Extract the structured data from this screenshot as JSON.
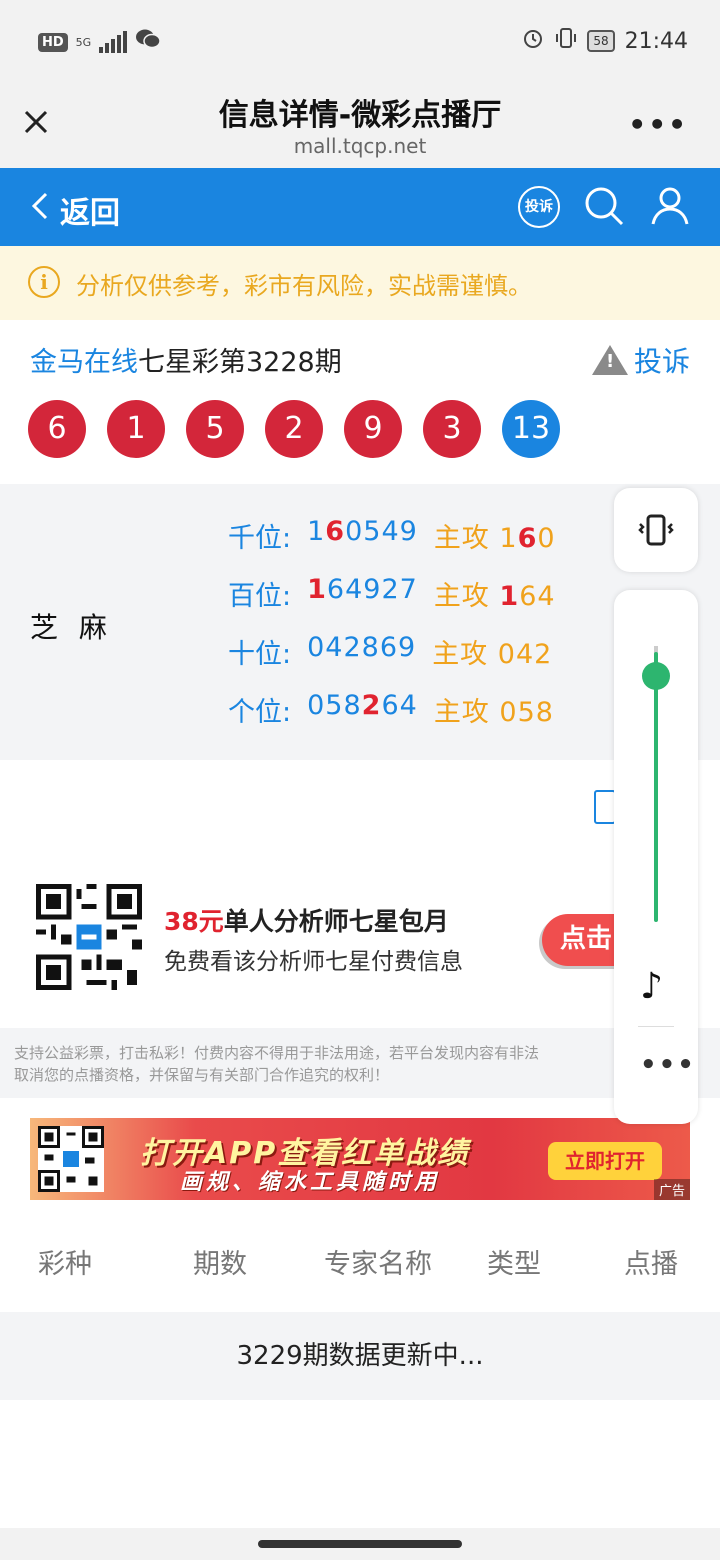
{
  "status_bar": {
    "hd": "HD",
    "network": "5G",
    "battery": "58",
    "time": "21:44"
  },
  "title_bar": {
    "title": "信息详情-微彩点播厅",
    "url": "mall.tqcp.net"
  },
  "nav": {
    "back_label": "返回",
    "complaint_label": "投诉"
  },
  "notice": {
    "text": "分析仅供参考，彩市有风险，实战需谨慎。"
  },
  "lottery": {
    "source": "金马在线",
    "title": "七星彩第3228期",
    "report_label": "投诉",
    "balls": [
      "6",
      "1",
      "5",
      "2",
      "9",
      "3",
      "13"
    ]
  },
  "analysis": {
    "author": "芝 麻",
    "rows": [
      {
        "pos": "千位:",
        "nums_pre": "1",
        "nums_hl": "6",
        "nums_post": "0549",
        "main_label": "主攻",
        "main_pre": "1",
        "main_hl": "6",
        "main_post": "0"
      },
      {
        "pos": "百位:",
        "nums_pre": "",
        "nums_hl": "1",
        "nums_post": "64927",
        "main_label": "主攻",
        "main_pre": "",
        "main_hl": "1",
        "main_post": "64"
      },
      {
        "pos": "十位:",
        "nums_pre": "042869",
        "nums_hl": "",
        "nums_post": "",
        "main_label": "主攻",
        "main_pre": "042",
        "main_hl": "",
        "main_post": ""
      },
      {
        "pos": "个位:",
        "nums_pre": "058",
        "nums_hl": "2",
        "nums_post": "64",
        "main_label": "主攻",
        "main_pre": "058",
        "main_hl": "",
        "main_post": ""
      }
    ]
  },
  "promo": {
    "price": "38元",
    "title": "单人分析师七星包月",
    "subtitle": "免费看该分析师七星付费信息",
    "button": "点击"
  },
  "disclaimer": {
    "line1": "支持公益彩票，打击私彩！付费内容不得用于非法用途，若平台发现内容有非法",
    "line2": "取消您的点播资格，并保留与有关部门合作追究的权利！"
  },
  "ad": {
    "line1": "打开APP查看红单战绩",
    "line2": "画规、缩水工具随时用",
    "button": "立即打开",
    "tag": "广告"
  },
  "table": {
    "headers": [
      "彩种",
      "期数",
      "专家名称",
      "类型",
      "点播"
    ],
    "update_text": "3229期数据更新中..."
  }
}
